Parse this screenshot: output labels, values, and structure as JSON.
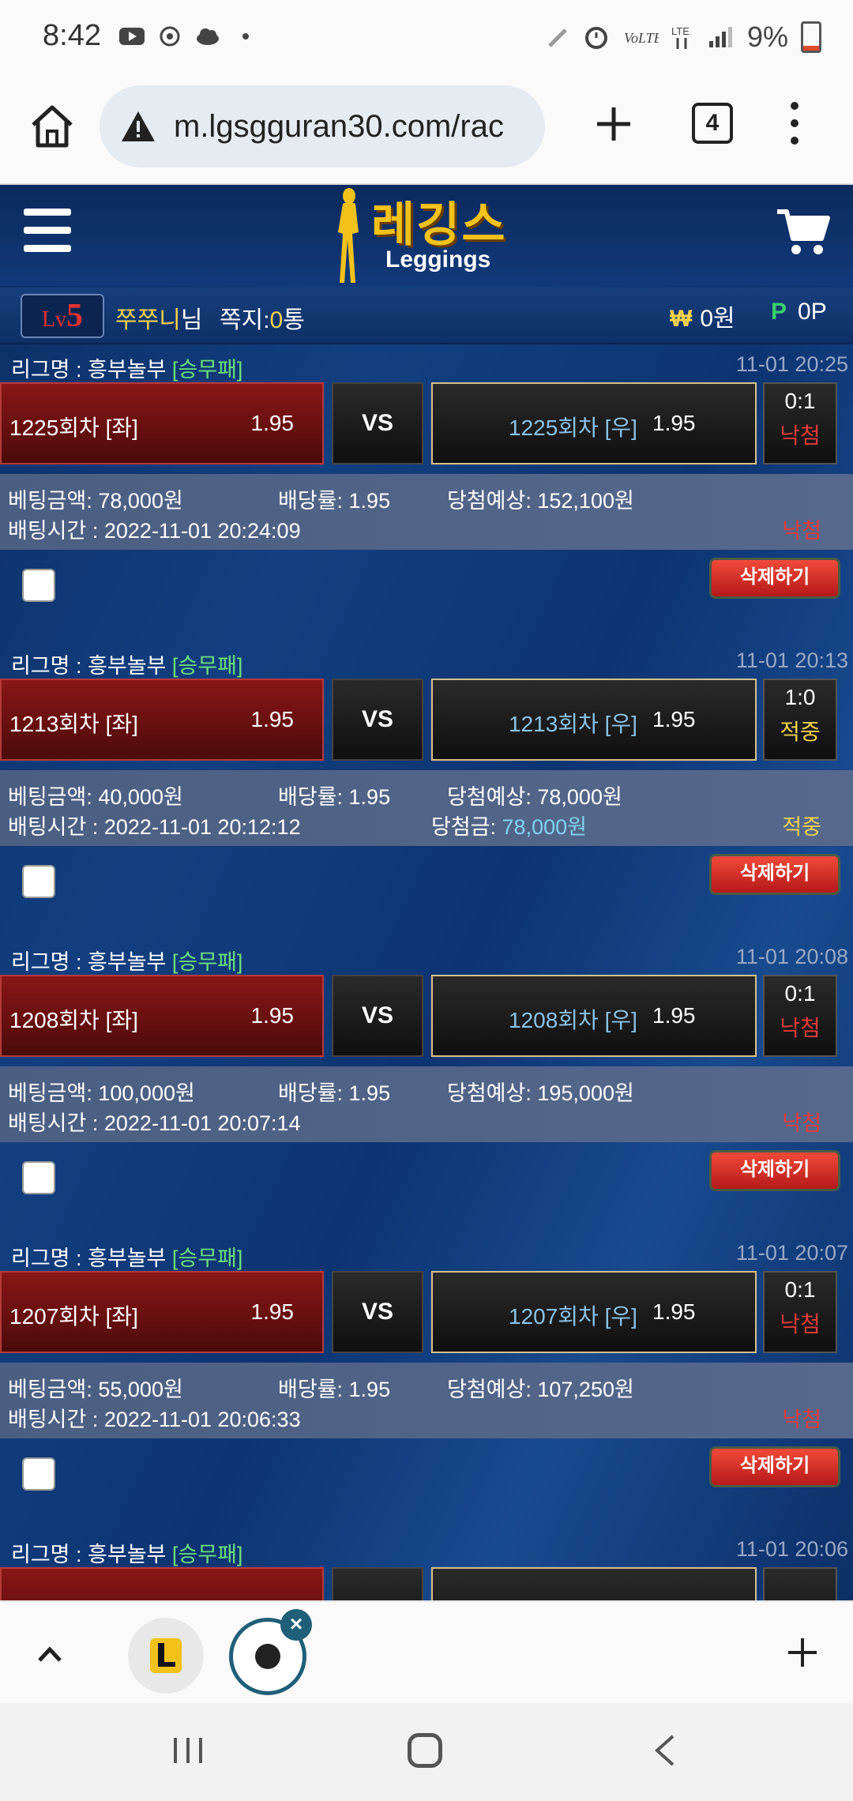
{
  "status_bar": {
    "time": "8:42",
    "battery": "9%"
  },
  "browser": {
    "url": "m.lgsgguran30.com/rac",
    "tab_count": "4"
  },
  "site": {
    "logo_kor": "레깅스",
    "logo_eng": "Leggings",
    "level_prefix": "Lv",
    "level_num": "5",
    "user_name": "쭈쭈니",
    "user_suffix": "님",
    "msg_label": "쪽지:",
    "msg_count": "0",
    "msg_unit": "통",
    "won_symbol": "₩",
    "won": "0원",
    "point_symbol": "P",
    "points": "0P"
  },
  "labels": {
    "league_prefix": "리그명 : 흥부놀부 ",
    "league_tag": "[승무패]",
    "vs": "VS",
    "bet_amount": "베팅금액: ",
    "odds": "배당률: ",
    "expected": "당첨예상: ",
    "bet_time": "배팅시간 : ",
    "paid": "당첨금: ",
    "delete": "삭제하기"
  },
  "bets": [
    {
      "date": "11-01 20:25",
      "home": "1225회차 [좌]",
      "home_odds": "1.95",
      "away": "1225회차 [우]",
      "away_odds": "1.95",
      "score": "0:1",
      "result": "낙첨",
      "amount": "78,000원",
      "odds": "1.95",
      "expected": "152,100원",
      "time": "2022-11-01 20:24:09",
      "paid": ""
    },
    {
      "date": "11-01 20:13",
      "home": "1213회차 [좌]",
      "home_odds": "1.95",
      "away": "1213회차 [우]",
      "away_odds": "1.95",
      "score": "1:0",
      "result": "적중",
      "amount": "40,000원",
      "odds": "1.95",
      "expected": "78,000원",
      "time": "2022-11-01 20:12:12",
      "paid": "78,000원"
    },
    {
      "date": "11-01 20:08",
      "home": "1208회차 [좌]",
      "home_odds": "1.95",
      "away": "1208회차 [우]",
      "away_odds": "1.95",
      "score": "0:1",
      "result": "낙첨",
      "amount": "100,000원",
      "odds": "1.95",
      "expected": "195,000원",
      "time": "2022-11-01 20:07:14",
      "paid": ""
    },
    {
      "date": "11-01 20:07",
      "home": "1207회차 [좌]",
      "home_odds": "1.95",
      "away": "1207회차 [우]",
      "away_odds": "1.95",
      "score": "0:1",
      "result": "낙첨",
      "amount": "55,000원",
      "odds": "1.95",
      "expected": "107,250원",
      "time": "2022-11-01 20:06:33",
      "paid": ""
    }
  ],
  "partial_bet": {
    "date": "11-01 20:06"
  },
  "colors": {
    "lose": "#e83a3a",
    "win": "#f2d34c",
    "league_tag": "#6fe07a"
  }
}
